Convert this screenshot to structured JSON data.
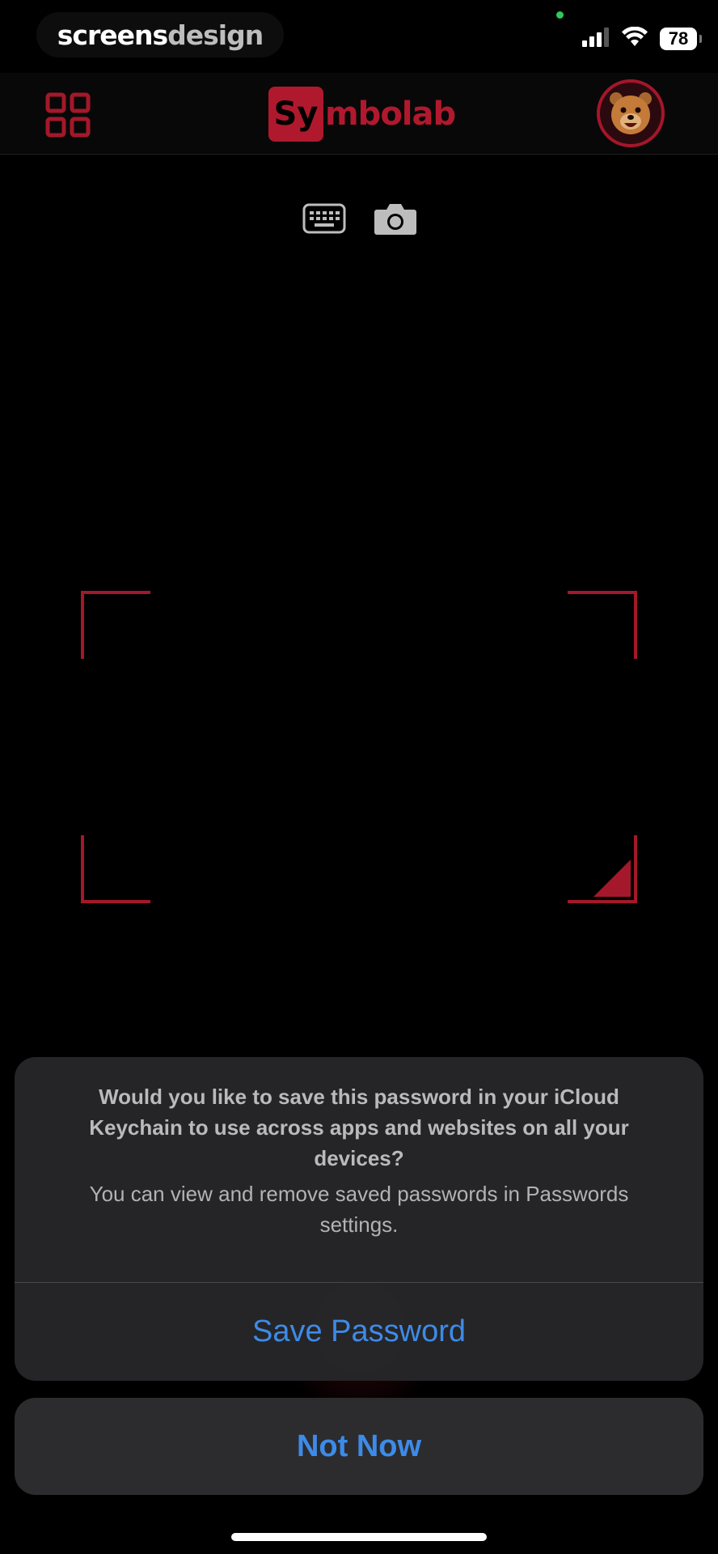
{
  "watermark": {
    "part1": "screens",
    "part2": "design"
  },
  "status_bar": {
    "battery": "78",
    "icons": [
      "cellular-icon",
      "wifi-icon",
      "battery-icon"
    ]
  },
  "header": {
    "menu_icon": "grid-icon",
    "logo": {
      "box_text": "Sy",
      "rest_text": "mbolab"
    },
    "avatar_icon": "bear-avatar-icon"
  },
  "input_modes": [
    "keyboard-icon",
    "camera-icon"
  ],
  "colors": {
    "accent": "#a3182a",
    "link": "#3d8be8",
    "sheet": "#262628"
  },
  "alert": {
    "title": "Would you like to save this password in your iCloud Keychain to use across apps and websites on all your devices?",
    "message": "You can view and remove saved passwords in Passwords settings.",
    "primary_button": "Save Password",
    "cancel_button": "Not Now"
  }
}
